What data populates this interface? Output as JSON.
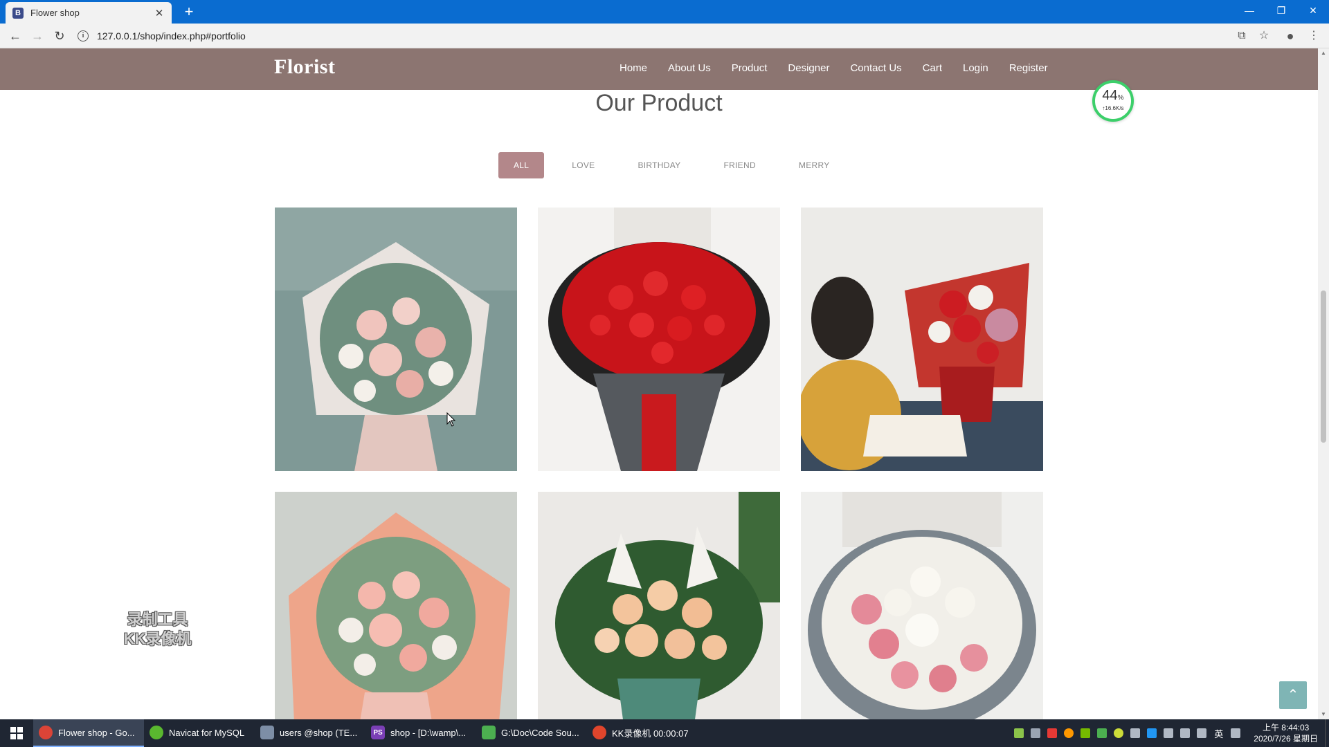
{
  "browser": {
    "tab_title": "Flower shop",
    "tab_favicon_letter": "B",
    "url": "127.0.0.1/shop/index.php#portfolio"
  },
  "site": {
    "brand": "Florist",
    "menu": [
      "Home",
      "About Us",
      "Product",
      "Designer",
      "Contact Us",
      "Cart",
      "Login",
      "Register"
    ]
  },
  "speed_widget": {
    "percent": "44",
    "unit": "%",
    "rate": "↑16.6K/s"
  },
  "section": {
    "title": "Our Product",
    "filters": [
      "ALL",
      "LOVE",
      "BIRTHDAY",
      "FRIEND",
      "MERRY"
    ],
    "active_filter": "ALL"
  },
  "products": [
    {
      "description": "pink rose bouquet in pale wrapping"
    },
    {
      "description": "red rose bouquet in black wrapping"
    },
    {
      "description": "red and white bouquet with figure"
    },
    {
      "description": "pink rose bouquet in peach wrapping"
    },
    {
      "description": "champagne rose and lily bouquet"
    },
    {
      "description": "white and pink rose bouquet"
    }
  ],
  "watermark": {
    "line1": "录制工具",
    "line2": "KK录像机"
  },
  "taskbar": {
    "tasks": [
      {
        "label": "Flower shop - Go...",
        "color": "#db4437",
        "active": true
      },
      {
        "label": "Navicat for MySQL",
        "color": "#5ab82f",
        "active": false
      },
      {
        "label": "users @shop (TE...",
        "color": "#7d8ea6",
        "active": false
      },
      {
        "label": "shop - [D:\\wamp\\...",
        "color": "#7a3fb5",
        "active": false
      },
      {
        "label": "G:\\Doc\\Code Sou...",
        "color": "#4caf50",
        "active": false
      },
      {
        "label": "KK录像机 00:00:07",
        "color": "#e0452c",
        "active": false
      }
    ],
    "ime": "英",
    "time": "上午 8:44:03",
    "date": "2020/7/26 星期日"
  }
}
